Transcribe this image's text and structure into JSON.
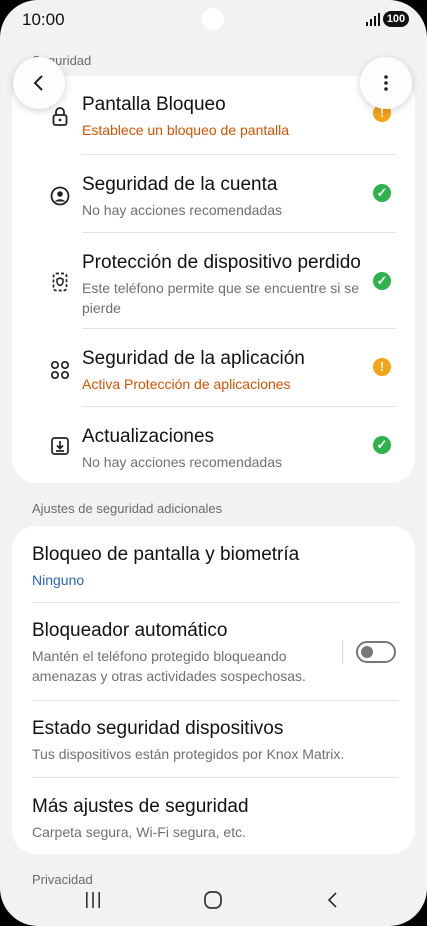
{
  "status": {
    "time": "10:00",
    "battery": "100"
  },
  "security": {
    "header": "Seguridad",
    "items": [
      {
        "icon": "lock-icon",
        "title": "Pantalla Bloqueo",
        "subtitle": "Establece un bloqueo de pantalla",
        "status": "warning"
      },
      {
        "icon": "account-icon",
        "title": "Seguridad de la cuenta",
        "subtitle": "No hay acciones recomendadas",
        "status": "ok"
      },
      {
        "icon": "lost-device-icon",
        "title": "Protección de dispositivo perdido",
        "subtitle": "Este teléfono permite que se encuentre si se pierde",
        "status": "ok"
      },
      {
        "icon": "apps-icon",
        "title": "Seguridad de la aplicación",
        "subtitle": "Activa Protección de aplicaciones",
        "status": "warning"
      },
      {
        "icon": "update-icon",
        "title": "Actualizaciones",
        "subtitle": "No hay acciones recomendadas",
        "status": "ok"
      }
    ],
    "badge_ok_glyph": "✓",
    "badge_warn_glyph": "!"
  },
  "additional": {
    "header": "Ajustes de seguridad adicionales",
    "items": [
      {
        "title": "Bloqueo de pantalla y biometría",
        "subtitle": "Ninguno"
      },
      {
        "title": "Bloqueador automático",
        "subtitle": "Mantén el teléfono protegido bloqueando amenazas y otras actividades sospechosas.",
        "toggle": false
      },
      {
        "title": "Estado seguridad dispositivos",
        "subtitle": "Tus dispositivos están protegidos por Knox Matrix."
      },
      {
        "title": "Más ajustes de seguridad",
        "subtitle": "Carpeta segura, Wi-Fi segura, etc."
      }
    ]
  },
  "privacy": {
    "header": "Privacidad"
  },
  "colors": {
    "warning": "#f4a417",
    "ok": "#2fb24b",
    "warning_text": "#d35400",
    "link": "#2b63c4"
  }
}
